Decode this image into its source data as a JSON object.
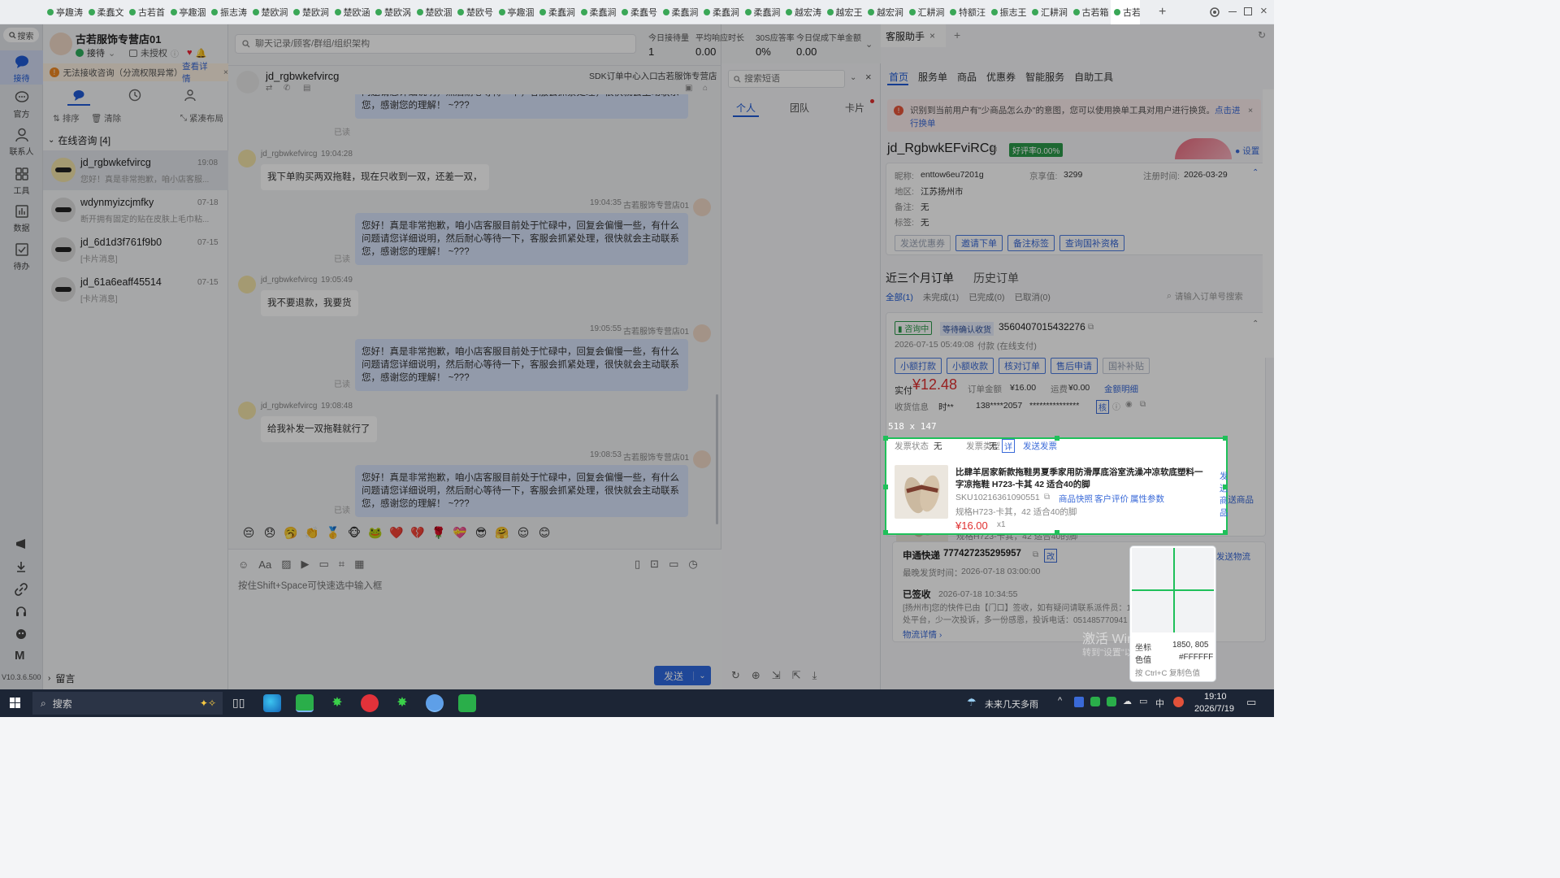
{
  "top_tabs": [
    "亭趣涛",
    "柔蠢文",
    "古若首",
    "亭趣涸",
    "振志涛",
    "楚欧涧",
    "楚欧涧",
    "楚欧涵",
    "楚欧涡",
    "楚欧涸",
    "楚欧号",
    "亭趣涸",
    "柔蠢涧",
    "柔蠢涧",
    "柔蠢号",
    "柔蠢涧",
    "柔蠢涧",
    "柔蠢涧",
    "越宏涛",
    "越宏王",
    "越宏涧",
    "汇耕涧",
    "特额汪",
    "振志王",
    "汇耕涧",
    "古若箱",
    "古若"
  ],
  "rail": {
    "search": "搜索",
    "items": [
      "接待",
      "官方",
      "联系人",
      "工具",
      "数据",
      "待办"
    ],
    "version": "V10.3.6.500"
  },
  "shop": {
    "name": "古若服饰专营店01",
    "status": "接待",
    "auth": "未授权",
    "warning": "无法接收咨询（分流权限异常）",
    "warning_link": "查看详情",
    "actions": [
      "排序",
      "清除",
      "紧凑布局"
    ],
    "online_group": "在线咨询 [4]",
    "footer": "留言"
  },
  "conversations": [
    {
      "name": "jd_rgbwkefvircg",
      "time": "19:08",
      "preview": "您好！真是非常抱歉，咱小店客服..."
    },
    {
      "name": "wdynmyizcjmfky",
      "time": "07-18",
      "preview": "断开拥有固定的贴在皮肤上毛巾粘..."
    },
    {
      "name": "jd_6d1d3f761f9b0",
      "time": "07-15",
      "preview": "[卡片消息]"
    },
    {
      "name": "jd_61a6eaff45514",
      "time": "07-15",
      "preview": "[卡片消息]"
    }
  ],
  "search": {
    "placeholder": "聊天记录/顾客/群组/组织架构"
  },
  "stats": [
    {
      "label": "今日接待量",
      "value": "1"
    },
    {
      "label": "平均响应时长",
      "value": "0.00"
    },
    {
      "label": "30S应答率",
      "value": "0%"
    },
    {
      "label": "今日促成下单金额",
      "value": "0.00"
    }
  ],
  "chat": {
    "customer": "jd_rgbwkefvircg",
    "sdk_label": "SDK订单中心入口",
    "shop_label": "古若服饰专营店",
    "agent": "古若服饰专营店01",
    "auto_reply": "您好！真是非常抱歉，咱小店客服目前处于忙碌中，回复会偏慢一些，有什么问题请您详细说明，然后耐心等待一下，客服会抓紧处理，很快就会主动联系您，感谢您的理解！ ~???",
    "read": "已读",
    "messages": [
      {
        "time": "19:04:28",
        "text": "我下单购买两双拖鞋，现在只收到一双，还差一双，"
      },
      {
        "time": "19:04:35"
      },
      {
        "time": "19:05:49",
        "text": "我不要退款，我要货"
      },
      {
        "time": "19:05:55"
      },
      {
        "time": "19:08:48",
        "text": "给我补发一双拖鞋就行了"
      },
      {
        "time": "19:08:53"
      }
    ],
    "emojis": [
      "😔",
      "😞",
      "🥱",
      "👏",
      "🥇",
      "🐵",
      "🐸",
      "❤️",
      "💔",
      "🌹",
      "💝",
      "😎",
      "🤗",
      "😌",
      "😊"
    ],
    "input_placeholder": "按住Shift+Space可快速选中输入框",
    "send": "发送"
  },
  "quick": {
    "placeholder": "搜索短语",
    "tabs": [
      "个人",
      "团队",
      "卡片"
    ]
  },
  "assistant": {
    "tab_title": "客服助手",
    "subtabs": [
      "首页",
      "服务单",
      "商品",
      "优惠券",
      "智能服务",
      "自助工具"
    ],
    "notice": "识别到当前用户有\"少商品怎么办\"的意图，您可以使用换单工具对用户进行换货。",
    "notice_link": "点击进行换单",
    "customer_id": "jd_RgbwkEFviRCg",
    "praise": "好评率0.00%",
    "settings": "设置",
    "info": {
      "nickname_label": "昵称:",
      "nickname": "enttow6eu7201g",
      "value_label": "京享值:",
      "value": "3299",
      "reg_label": "注册时间:",
      "reg": "2026-03-29",
      "region_label": "地区:",
      "region": "江苏扬州市",
      "remark_label": "备注:",
      "remark": "无",
      "tag_label": "标签:",
      "tag": "无"
    },
    "info_buttons": [
      "发送优惠券",
      "邀请下单",
      "备注标签",
      "查询国补资格"
    ],
    "orders_tabs": [
      "近三个月订单",
      "历史订单"
    ],
    "filters": [
      "全部(1)",
      "未完成(1)",
      "已完成(0)",
      "已取消(0)"
    ],
    "order_search": "请输入订单号搜索",
    "order": {
      "status": "咨询中",
      "state": "等待确认收货",
      "id": "3560407015432276",
      "date": "2026-07-15 05:49:08",
      "pay": "付款 (在线支付)",
      "actions": [
        "小额打款",
        "小额收款",
        "核对订单",
        "售后申请",
        "国补补贴"
      ],
      "paid_label": "实付",
      "paid": "¥12.48",
      "total_label": "订单金额",
      "total": "¥16.00",
      "ship_label": "运费",
      "ship": "¥0.00",
      "detail": "金额明细",
      "recv_label": "收货信息",
      "recv_name": "时**",
      "recv_phone": "138****2057",
      "recv_addr": "***************",
      "check": "核",
      "invoice_status_label": "发票状态",
      "invoice_status": "无",
      "invoice_type_label": "发票类型",
      "invoice_type": "无",
      "invoice_tag": "详",
      "invoice_link": "发送发票",
      "product": {
        "title": "比肆羊居家新款拖鞋男夏季家用防滑厚底浴室洗澡冲凉软底塑料一字凉拖鞋 H723-卡其 42 适合40的脚",
        "sku_label": "SKU",
        "sku": "10216361090551",
        "links": [
          "商品快照",
          "客户评价",
          "属性参数"
        ],
        "spec": "规格H723-卡其，42 适合40的脚",
        "price": "¥16.00",
        "qty": "x1",
        "send": "发送商品"
      },
      "express": {
        "label": "申通快递",
        "no": "777427235295957",
        "edit": "改",
        "latest_label": "最晚发货时间：",
        "latest": "2026-07-18 03:00:00",
        "signed": "已签收",
        "signed_time": "2026-07-18 10:34:55",
        "detail": "[扬州市]您的快件已由【门口】签收，如有疑问请联系派件员：1",
        "detail2": "处平台，少一次投诉，多一份感恩，投诉电话：051485770941",
        "more": "物流详情",
        "send": "发送物流"
      }
    }
  },
  "overlay": {
    "size": "518 x 147",
    "coord_label": "坐标",
    "coord": "1850, 805",
    "color_label": "色值",
    "color_value": "#FFFFFF",
    "hint": "按 Ctrl+C 复制色值"
  },
  "watermark": {
    "line1": "激活 Windows",
    "line2": "转到\"设置\"以激活 Windows"
  },
  "taskbar": {
    "search": "搜索",
    "weather": "未来几天多雨",
    "time": "19:10",
    "date": "2026/7/19",
    "ime": "中"
  }
}
